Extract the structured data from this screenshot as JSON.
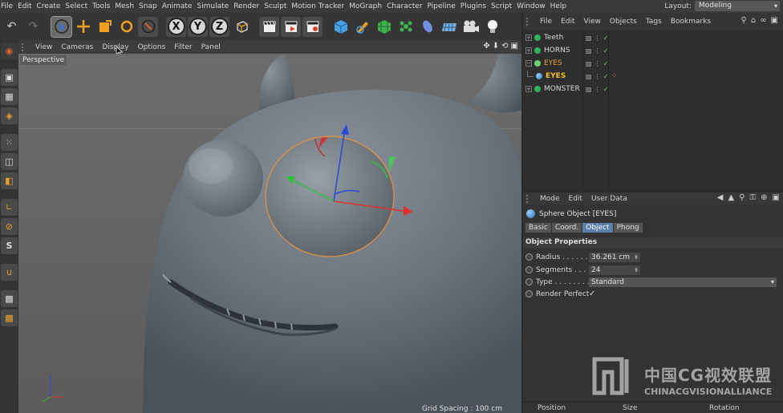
{
  "menubar": {
    "items": [
      "File",
      "Edit",
      "Create",
      "Select",
      "Tools",
      "Mesh",
      "Snap",
      "Animate",
      "Simulate",
      "Render",
      "Sculpt",
      "Motion Tracker",
      "MoGraph",
      "Character",
      "Pipeline",
      "Plugins",
      "Script",
      "Window",
      "Help"
    ],
    "layout_label": "Layout:",
    "layout_value": "Modeling"
  },
  "toolbar": {
    "axis_x": "X",
    "axis_y": "Y",
    "axis_z": "Z"
  },
  "object_manager": {
    "tabs": [
      "File",
      "Edit",
      "View",
      "Objects",
      "Tags",
      "Bookmarks"
    ],
    "rows": [
      {
        "name": "Teeth",
        "color": "#d8d8d8",
        "active": false
      },
      {
        "name": "HORNS",
        "color": "#d8d8d8",
        "active": false
      },
      {
        "name": "EYES",
        "color": "#e8a030",
        "active": true
      },
      {
        "name": "EYES",
        "color": "#f0c020",
        "active": true
      },
      {
        "name": "MONSTER",
        "color": "#d8d8d8",
        "active": false
      }
    ]
  },
  "viewport": {
    "menu": [
      "View",
      "Cameras",
      "Display",
      "Options",
      "Filter",
      "Panel"
    ],
    "camera_label": "Perspective",
    "grid_spacing": "Grid Spacing : 100 cm"
  },
  "attribute_manager": {
    "menu": [
      "Mode",
      "Edit",
      "User Data"
    ],
    "object_title": "Sphere Object [EYES]",
    "tabs": [
      "Basic",
      "Coord.",
      "Object",
      "Phong"
    ],
    "active_tab": "Object",
    "section_title": "Object Properties",
    "radius_label": "Radius . . . . . . . .",
    "radius_value": "36.261 cm",
    "segments_label": "Segments . . . .",
    "segments_value": "24",
    "type_label": "Type . . . . . . . . .",
    "type_value": "Standard",
    "render_perfect_label": "Render Perfect",
    "render_perfect_checked": "✓"
  },
  "coordinates": {
    "position": "Position",
    "size": "Size",
    "rotation": "Rotation"
  },
  "watermark": {
    "cn": "中国CG视效联盟",
    "en": "CHINACGVISIONALLIANCE"
  }
}
